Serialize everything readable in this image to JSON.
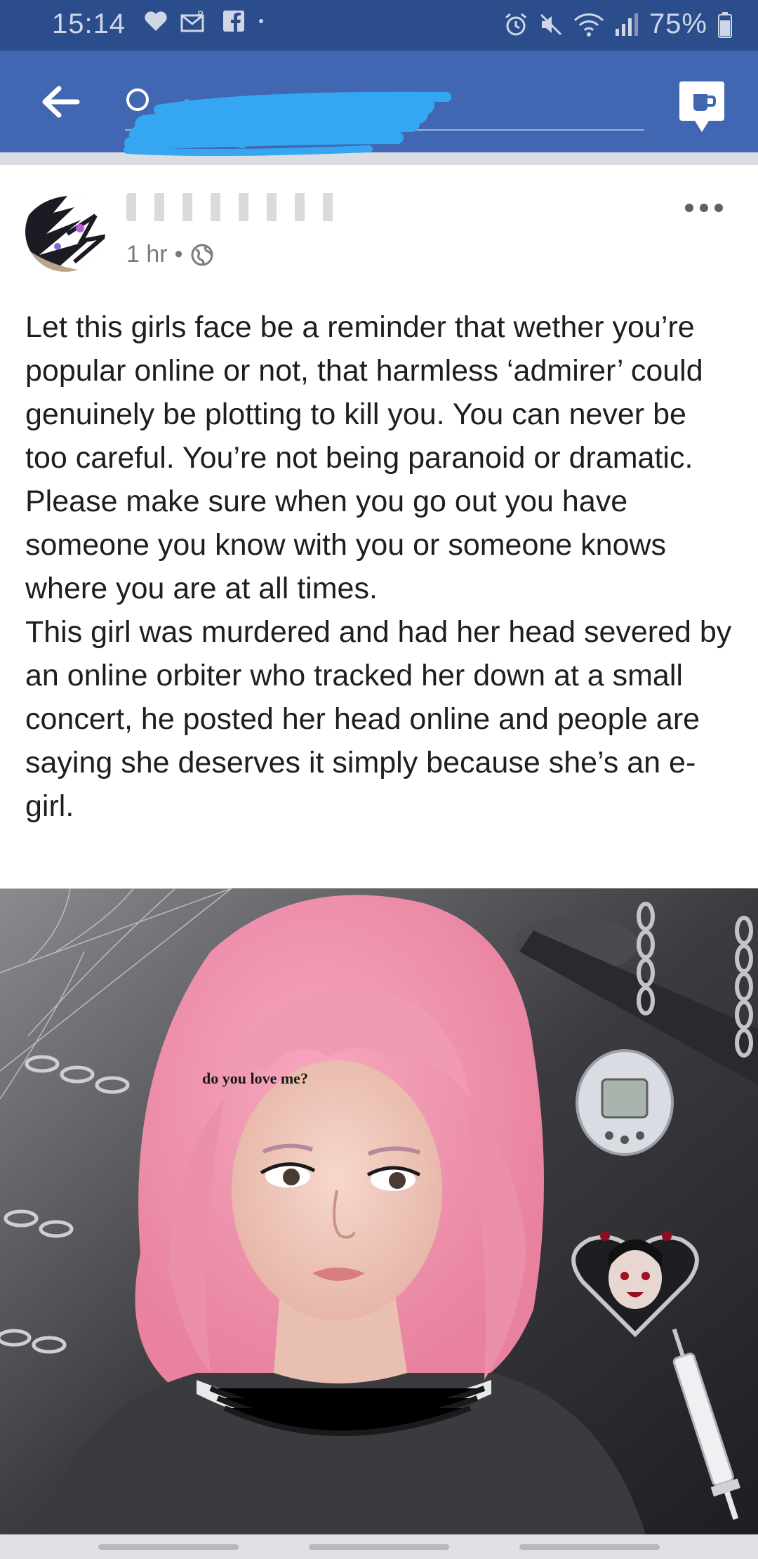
{
  "status_bar": {
    "time": "15:14",
    "battery": "75%",
    "left_icons": [
      "heart-icon",
      "b-mail-icon",
      "facebook-icon",
      "dot-icon"
    ],
    "right_icons": [
      "alarm-icon",
      "mute-icon",
      "wifi-icon",
      "signal-icon",
      "battery-icon"
    ]
  },
  "app_bar": {
    "search_value": "",
    "colors": {
      "bar": "#4267b2",
      "status": "#2c4d8c",
      "redaction": "#35a7f2"
    }
  },
  "post": {
    "author": "",
    "time": "1 hr",
    "separator": "•",
    "privacy_icon": "globe-icon",
    "text_paragraph_1": "Let this girls face be a reminder that wether you’re popular online or not, that harmless ‘admirer’ could genuinely be plotting to kill you. You can never be too careful. You’re not being paranoid or dramatic. Please make sure when you go out you have someone you know with you or someone knows where you are at all times.",
    "text_paragraph_2": "This girl was murdered and had her head severed by an online orbiter who tracked her down at a small concert, he posted her head online and people are saying she deserves it simply because she’s an e-girl.",
    "photo_caption": "do you love me?"
  }
}
